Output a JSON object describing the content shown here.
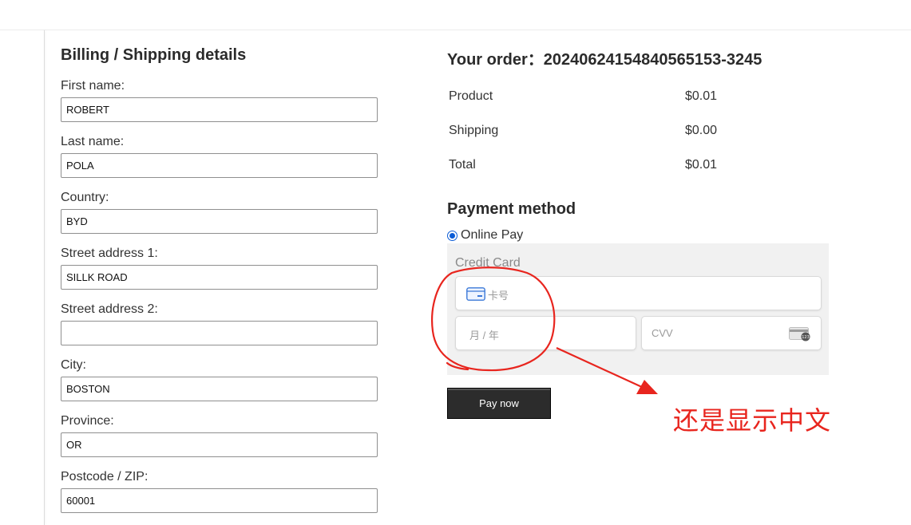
{
  "billing": {
    "title": "Billing / Shipping details",
    "fields": [
      {
        "label": "First name:",
        "value": "ROBERT"
      },
      {
        "label": "Last name:",
        "value": "POLA"
      },
      {
        "label": "Country:",
        "value": "BYD"
      },
      {
        "label": "Street address 1:",
        "value": "SILLK ROAD"
      },
      {
        "label": "Street address 2:",
        "value": ""
      },
      {
        "label": "City:",
        "value": "BOSTON"
      },
      {
        "label": "Province:",
        "value": "OR"
      },
      {
        "label": "Postcode / ZIP:",
        "value": "60001"
      }
    ]
  },
  "order": {
    "title": "Your order：20240624154840565153-3245",
    "rows": [
      {
        "label": "Product",
        "value": "$0.01"
      },
      {
        "label": "Shipping",
        "value": "$0.00"
      },
      {
        "label": "Total",
        "value": "$0.01"
      }
    ]
  },
  "payment": {
    "title": "Payment method",
    "option_label": "Online Pay",
    "card_title": "Credit Card",
    "card_number_placeholder": "卡号",
    "expiry_placeholder": "月 / 年",
    "cvv_placeholder": "CVV",
    "cvv_icon_text": "123",
    "pay_button": "Pay now"
  },
  "annotation": {
    "text": "还是显示中文",
    "color": "#e8251e"
  },
  "colors": {
    "accent": "#0b5cd6",
    "button": "#2c2c2c"
  }
}
